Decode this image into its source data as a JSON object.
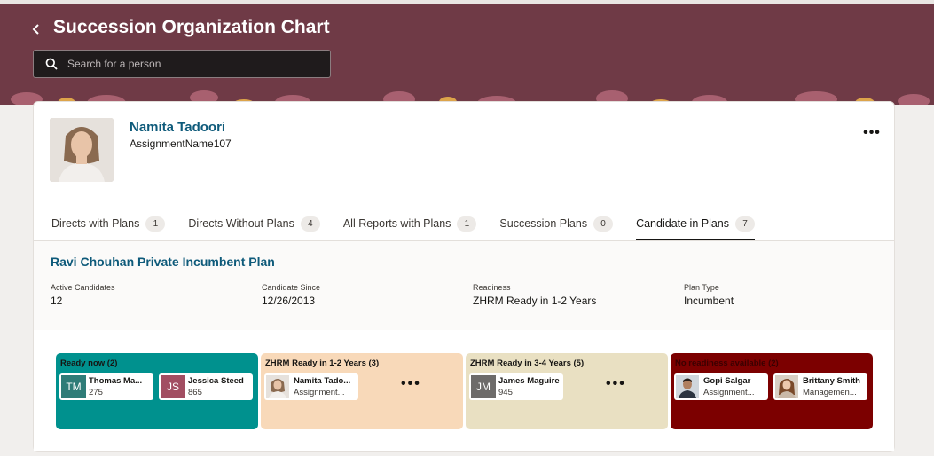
{
  "header": {
    "title": "Succession Organization Chart",
    "back_icon": "chevron-left-icon",
    "search_placeholder": "Search for a person",
    "search_value": "",
    "colors": {
      "banner": "#6f3a46",
      "search_bg": "#1f1b1c"
    }
  },
  "profile": {
    "name": "Namita Tadoori",
    "assignment": "AssignmentName107",
    "more_label": "•••"
  },
  "tabs": [
    {
      "label": "Directs with Plans",
      "count": "1"
    },
    {
      "label": "Directs Without Plans",
      "count": "4"
    },
    {
      "label": "All Reports with Plans",
      "count": "1"
    },
    {
      "label": "Succession Plans",
      "count": "0"
    },
    {
      "label": "Candidate in Plans",
      "count": "7",
      "active": true
    }
  ],
  "plan": {
    "title": "Ravi Chouhan Private Incumbent Plan",
    "meta": [
      {
        "label": "Active Candidates",
        "value": "12"
      },
      {
        "label": "Candidate Since",
        "value": "12/26/2013"
      },
      {
        "label": "Readiness",
        "value": "ZHRM Ready in 1-2 Years"
      },
      {
        "label": "Plan Type",
        "value": "Incumbent"
      }
    ]
  },
  "lanes": [
    {
      "title": "Ready now (2)",
      "color": "#00918e",
      "candidates": [
        {
          "initials": "TM",
          "name": "Thomas Ma...",
          "sub": "275",
          "avatar_color": "#2f7c78"
        },
        {
          "initials": "JS",
          "name": "Jessica Steed",
          "sub": "865",
          "avatar_color": "#a24e62"
        }
      ],
      "more": ""
    },
    {
      "title": "ZHRM Ready in 1-2 Years (3)",
      "color": "#f8d9b9",
      "candidates": [
        {
          "initials": "",
          "name": "Namita Tado...",
          "sub": "Assignment...",
          "avatar": "photo-woman"
        }
      ],
      "more": "•••"
    },
    {
      "title": "ZHRM Ready in 3-4 Years (5)",
      "color": "#e9e0c2",
      "candidates": [
        {
          "initials": "JM",
          "name": "James Maguire",
          "sub": "945",
          "avatar_color": "#6d6b6a"
        }
      ],
      "more": "•••"
    },
    {
      "title": "No readiness available (2)",
      "color": "#7c0000",
      "candidates": [
        {
          "initials": "",
          "name": "Gopi Salgar",
          "sub": "Assignment...",
          "avatar": "photo-man"
        },
        {
          "initials": "",
          "name": "Brittany Smith",
          "sub": "Managemen...",
          "avatar": "photo-woman2"
        }
      ],
      "more": ""
    }
  ]
}
